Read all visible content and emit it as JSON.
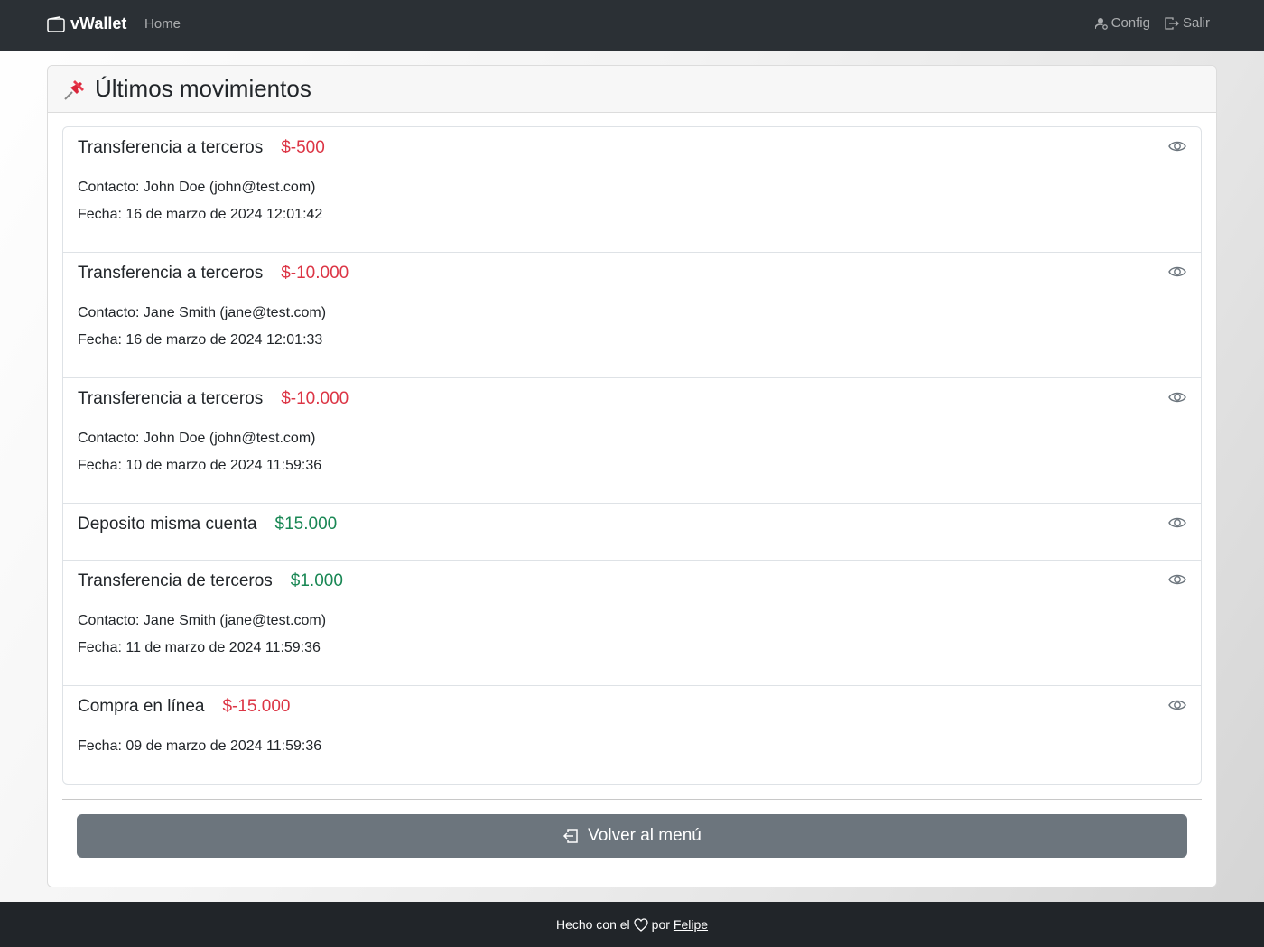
{
  "navbar": {
    "brand": "vWallet",
    "brand_icon": "wallet-icon",
    "home_label": "Home",
    "config_label": "Config",
    "config_icon": "person-gear-icon",
    "logout_label": "Salir",
    "logout_icon": "box-arrow-right-icon"
  },
  "page": {
    "title": "Últimos movimientos",
    "title_icon": "pushpin-icon"
  },
  "movements": [
    {
      "name": "Transferencia a terceros",
      "amount": "$-500",
      "type": "negative",
      "contact": "Contacto: John Doe (john@test.com)",
      "date": "Fecha: 16 de marzo de 2024 12:01:42"
    },
    {
      "name": "Transferencia a terceros",
      "amount": "$-10.000",
      "type": "negative",
      "contact": "Contacto: Jane Smith (jane@test.com)",
      "date": "Fecha: 16 de marzo de 2024 12:01:33"
    },
    {
      "name": "Transferencia a terceros",
      "amount": "$-10.000",
      "type": "negative",
      "contact": "Contacto: John Doe (john@test.com)",
      "date": "Fecha: 10 de marzo de 2024 11:59:36"
    },
    {
      "name": "Deposito misma cuenta",
      "amount": "$15.000",
      "type": "positive"
    },
    {
      "name": "Transferencia de terceros",
      "amount": "$1.000",
      "type": "positive",
      "contact": "Contacto: Jane Smith (jane@test.com)",
      "date": "Fecha: 11 de marzo de 2024 11:59:36"
    },
    {
      "name": "Compra en línea",
      "amount": "$-15.000",
      "type": "negative",
      "date": "Fecha: 09 de marzo de 2024 11:59:36"
    }
  ],
  "back_button": {
    "label": "Volver al menú",
    "icon": "box-arrow-in-left-icon"
  },
  "footer": {
    "prefix": "Hecho con el",
    "icon": "heart-icon",
    "middle": "por",
    "author": "Felipe"
  },
  "colors": {
    "negative": "#dc3545",
    "positive": "#198754",
    "navbar": "#2b3035",
    "button": "#6c757d"
  }
}
